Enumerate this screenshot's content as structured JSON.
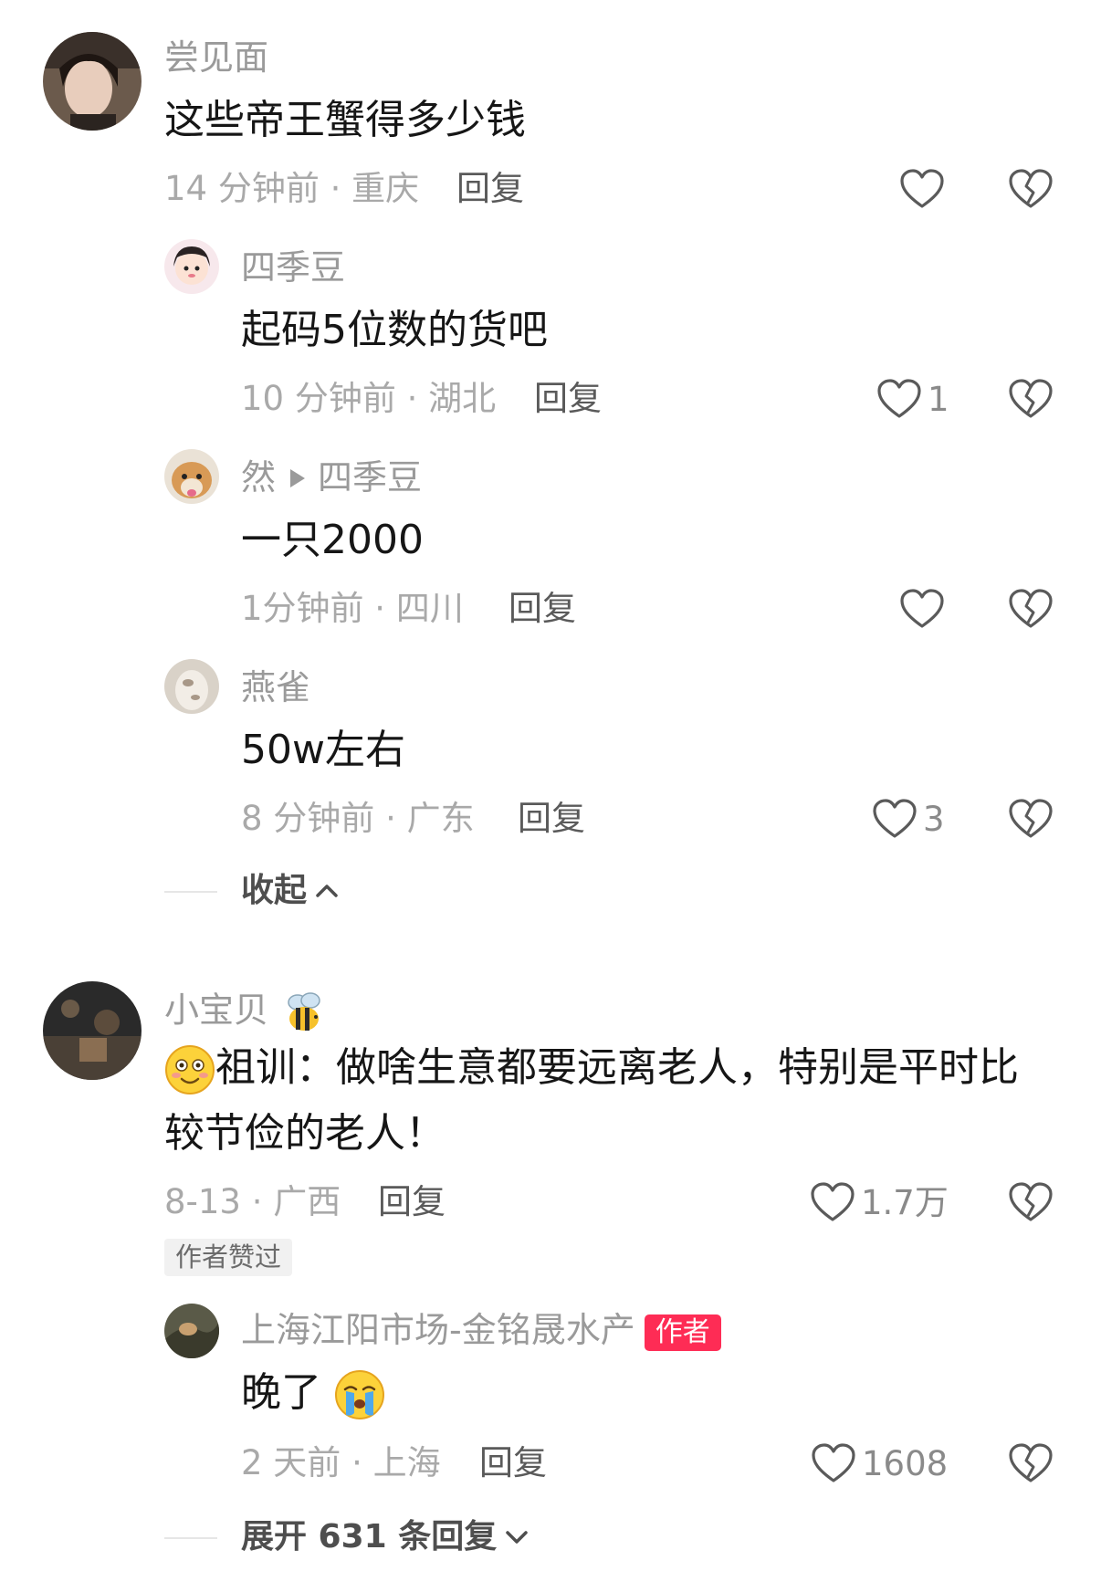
{
  "comments": [
    {
      "username": "尝见面",
      "text": "这些帝王蟹得多少钱",
      "time": "14 分钟前 · 重庆",
      "reply_label": "回复",
      "likes": "",
      "replies": [
        {
          "username": "四季豆",
          "text": "起码5位数的货吧",
          "time": "10 分钟前 · 湖北",
          "reply_label": "回复",
          "likes": "1"
        },
        {
          "username": "然",
          "reply_to": "四季豆",
          "text": "一只2000",
          "time": "1分钟前 · 四川",
          "reply_label": "回复",
          "likes": ""
        },
        {
          "username": "燕雀",
          "text": "50w左右",
          "time": "8 分钟前 · 广东",
          "reply_label": "回复",
          "likes": "3"
        }
      ],
      "collapse_label": "收起"
    },
    {
      "username": "小宝贝",
      "text_line1": "祖训：做啥生意都要远离老人，特别是平时比",
      "text_line2": "较节俭的老人！",
      "time": "8-13 · 广西",
      "reply_label": "回复",
      "likes": "1.7万",
      "author_liked_badge": "作者赞过",
      "replies": [
        {
          "username": "上海江阳市场-金铭晟水产",
          "author_badge": "作者",
          "text": "晚了",
          "time": "2 天前 · 上海",
          "reply_label": "回复",
          "likes": "1608"
        }
      ],
      "expand_label": "展开 631 条回复"
    }
  ],
  "colors": {
    "username": "#9a9a9a",
    "text": "#161616",
    "meta": "#a9a9a9",
    "author_badge_bg": "#fe2c55",
    "liked_badge_bg": "#f1f1f1"
  },
  "icons": [
    "heart-outline-icon",
    "broken-heart-icon",
    "chevron-up-icon",
    "chevron-down-icon",
    "play-arrow-icon",
    "smiling-face-emoji",
    "crying-face-emoji",
    "bee-emoji"
  ]
}
